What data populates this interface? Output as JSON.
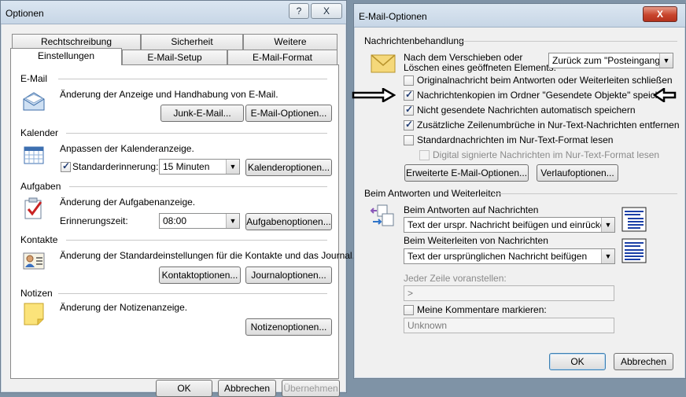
{
  "left_window": {
    "title": "Optionen",
    "help_glyph": "?",
    "close_glyph": "X",
    "tabs_row1": [
      "Rechtschreibung",
      "Sicherheit",
      "Weitere"
    ],
    "tabs_row2": [
      "Einstellungen",
      "E-Mail-Setup",
      "E-Mail-Format"
    ],
    "email": {
      "heading": "E-Mail",
      "desc": "Änderung der Anzeige und Handhabung von E-Mail.",
      "junk_btn": "Junk-E-Mail...",
      "options_btn": "E-Mail-Optionen..."
    },
    "calendar": {
      "heading": "Kalender",
      "desc": "Anpassen der Kalenderanzeige.",
      "reminder_label": "Standarderinnerung:",
      "reminder_value": "15 Minuten",
      "options_btn": "Kalenderoptionen..."
    },
    "tasks": {
      "heading": "Aufgaben",
      "desc": "Änderung der Aufgabenanzeige.",
      "time_label": "Erinnerungszeit:",
      "time_value": "08:00",
      "options_btn": "Aufgabenoptionen..."
    },
    "contacts": {
      "heading": "Kontakte",
      "desc": "Änderung der Standardeinstellungen für die Kontakte und das Journal.",
      "contact_btn": "Kontaktoptionen...",
      "journal_btn": "Journaloptionen..."
    },
    "notes": {
      "heading": "Notizen",
      "desc": "Änderung der Notizenanzeige.",
      "options_btn": "Notizenoptionen..."
    },
    "bottom_buttons": [
      "OK",
      "Abbrechen",
      "Übernehmen"
    ]
  },
  "right_window": {
    "title": "E-Mail-Optionen",
    "close_glyph": "X",
    "handling": {
      "heading": "Nachrichtenbehandlung",
      "move_label_1": "Nach dem Verschieben oder",
      "move_label_2": "Löschen eines geöffneten Elements:",
      "move_value": "Zurück zum \"Posteingang\"",
      "checkboxes": [
        {
          "label": "Originalnachricht beim Antworten oder Weiterleiten schließen",
          "checked": false
        },
        {
          "label": "Nachrichtenkopien im Ordner \"Gesendete Objekte\" speichern",
          "checked": true
        },
        {
          "label": "Nicht gesendete Nachrichten automatisch speichern",
          "checked": true
        },
        {
          "label": "Zusätzliche Zeilenumbrüche in Nur-Text-Nachrichten entfernen",
          "checked": true
        },
        {
          "label": "Standardnachrichten im Nur-Text-Format lesen",
          "checked": false
        },
        {
          "label": "Digital signierte Nachrichten im Nur-Text-Format lesen",
          "checked": false,
          "disabled": true
        }
      ],
      "advanced_btn": "Erweiterte E-Mail-Optionen...",
      "tracking_btn": "Verlaufoptionen..."
    },
    "reply": {
      "heading": "Beim Antworten und Weiterleiten",
      "reply_label": "Beim Antworten auf Nachrichten",
      "reply_value": "Text der urspr. Nachricht beifügen und einrücken",
      "forward_label": "Beim Weiterleiten von Nachrichten",
      "forward_value": "Text der ursprünglichen Nachricht beifügen",
      "prefix_label": "Jeder Zeile voranstellen:",
      "prefix_value": ">",
      "mark_label": "Meine Kommentare markieren:",
      "mark_value": "Unknown"
    },
    "ok_btn": "OK",
    "cancel_btn": "Abbrechen"
  },
  "colors": {
    "background": "#7f93a6",
    "dialog": "#f0f0f0",
    "close_red": "#c8452d",
    "focus_blue": "#3c7fb1"
  }
}
